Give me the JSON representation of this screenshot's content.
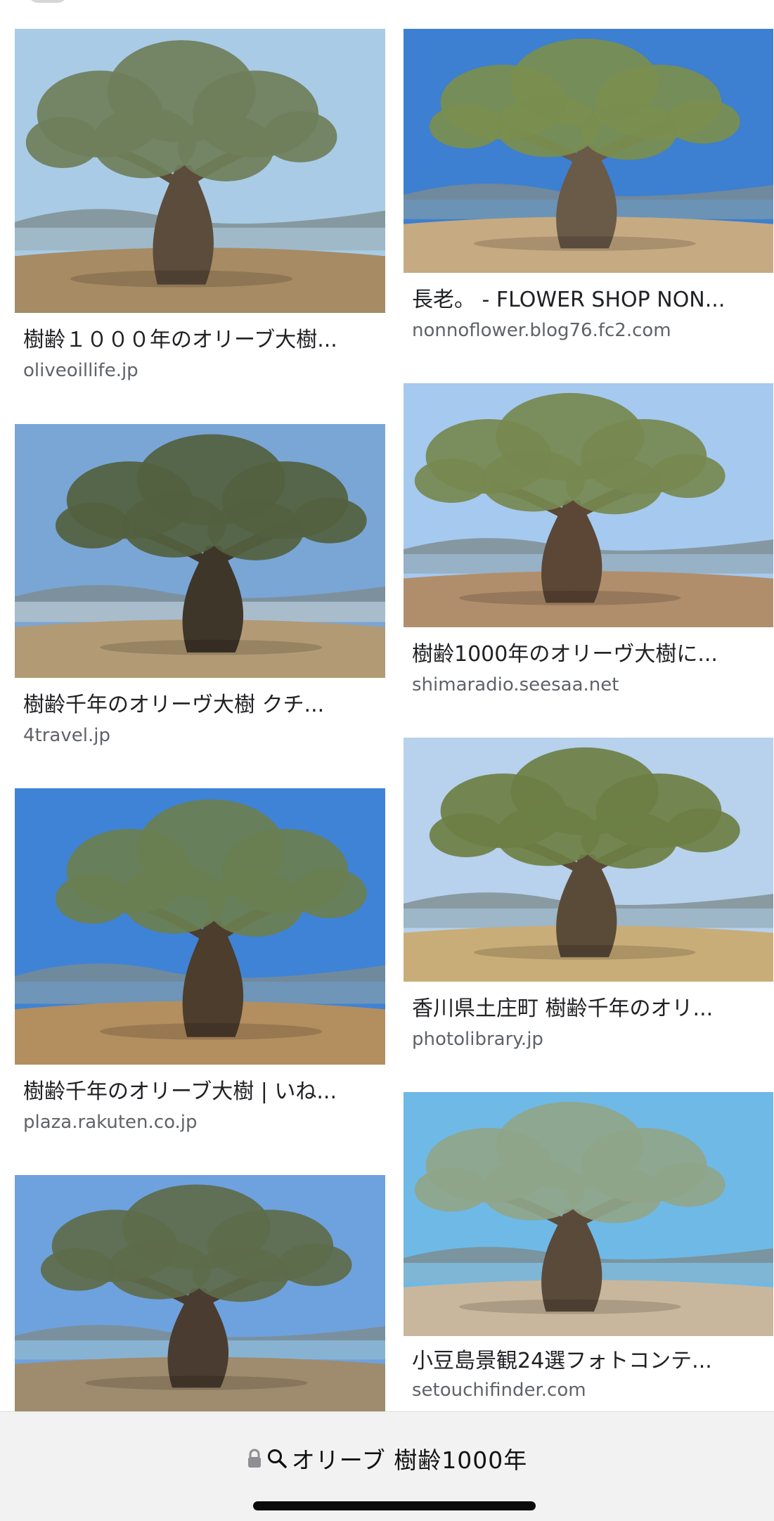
{
  "results": [
    {
      "caption": "樹齢１０００年のオリーブ大樹...",
      "domain": "oliveoillife.jp",
      "thumb_icon": "olive-tree-image",
      "palette": {
        "sky": "#a9cbe6",
        "ground": "#a78b64",
        "foliage": "#6f7f5a",
        "trunk": "#5b4c3b",
        "water": "#9fb9c9"
      }
    },
    {
      "caption": "長老。 - FLOWER SHOP NON...",
      "domain": "nonnoflower.blog76.fc2.com",
      "thumb_icon": "olive-tree-image",
      "palette": {
        "sky": "#3d7fd0",
        "ground": "#c6aa82",
        "foliage": "#7a8e4e",
        "trunk": "#6a5a48",
        "water": "#6b93b5"
      }
    },
    {
      "caption": "樹齢千年のオリーヴ大樹 クチ...",
      "domain": "4travel.jp",
      "thumb_icon": "olive-tree-image",
      "palette": {
        "sky": "#7aa6d6",
        "ground": "#b19a74",
        "foliage": "#52613f",
        "trunk": "#3f362a",
        "water": "#a8bccc"
      }
    },
    {
      "caption": "樹齢1000年のオリーヴ大樹に...",
      "domain": "shimaradio.seesaa.net",
      "thumb_icon": "olive-tree-image",
      "palette": {
        "sky": "#a6c9ef",
        "ground": "#b08e6b",
        "foliage": "#76884f",
        "trunk": "#5c4636",
        "water": "#97b1c6"
      }
    },
    {
      "caption": "香川県土庄町 樹齢千年のオリ...",
      "domain": "photolibrary.jp",
      "thumb_icon": "olive-tree-image",
      "palette": {
        "sky": "#b8d1ec",
        "ground": "#c9ad78",
        "foliage": "#6d7f44",
        "trunk": "#5a4b38",
        "water": "#9db6c8"
      }
    },
    {
      "caption": "樹齢千年のオリーブ大樹 | いね...",
      "domain": "plaza.rakuten.co.jp",
      "thumb_icon": "olive-tree-image",
      "palette": {
        "sky": "#3f83d6",
        "ground": "#b38e5f",
        "foliage": "#6a7f50",
        "trunk": "#4d3d2c",
        "water": "#6f95b8"
      }
    },
    {
      "caption": "小豆島景観24選フォトコンテ...",
      "domain": "setouchifinder.com",
      "thumb_icon": "olive-tree-image",
      "palette": {
        "sky": "#6fb9e6",
        "ground": "#c8b79d",
        "foliage": "#8fa58a",
        "trunk": "#5a4a3a",
        "water": "#7fb6d6"
      }
    },
    {
      "caption": "",
      "domain": "",
      "thumb_icon": "olive-tree-image",
      "palette": {
        "sky": "#6ea2de",
        "ground": "#9f8b6d",
        "foliage": "#5d6b4a",
        "trunk": "#4a3c30",
        "water": "#88b2d2"
      }
    }
  ],
  "address_bar": {
    "lock_icon": "lock-icon",
    "search_icon": "search-icon",
    "query": "オリーブ 樹齢1000年"
  }
}
